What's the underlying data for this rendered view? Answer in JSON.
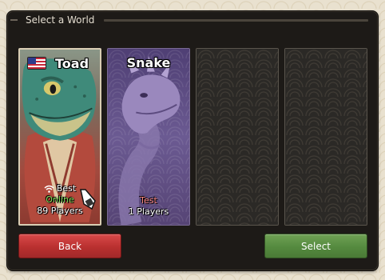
{
  "dialog": {
    "title": "Select a World"
  },
  "worlds": [
    {
      "name": "Toad",
      "flag": "us-flag-icon",
      "quality": "Best",
      "status": "Online",
      "players": "89 Players",
      "selected": true
    },
    {
      "name": "Snake",
      "status": "Test",
      "players": "1 Players",
      "selected": false
    }
  ],
  "empty_slots": 2,
  "buttons": {
    "back": "Back",
    "select": "Select"
  },
  "colors": {
    "online": "#7fe05a",
    "test": "#ff8a8a",
    "back_button": "#c23a39",
    "select_button": "#5c9145"
  }
}
